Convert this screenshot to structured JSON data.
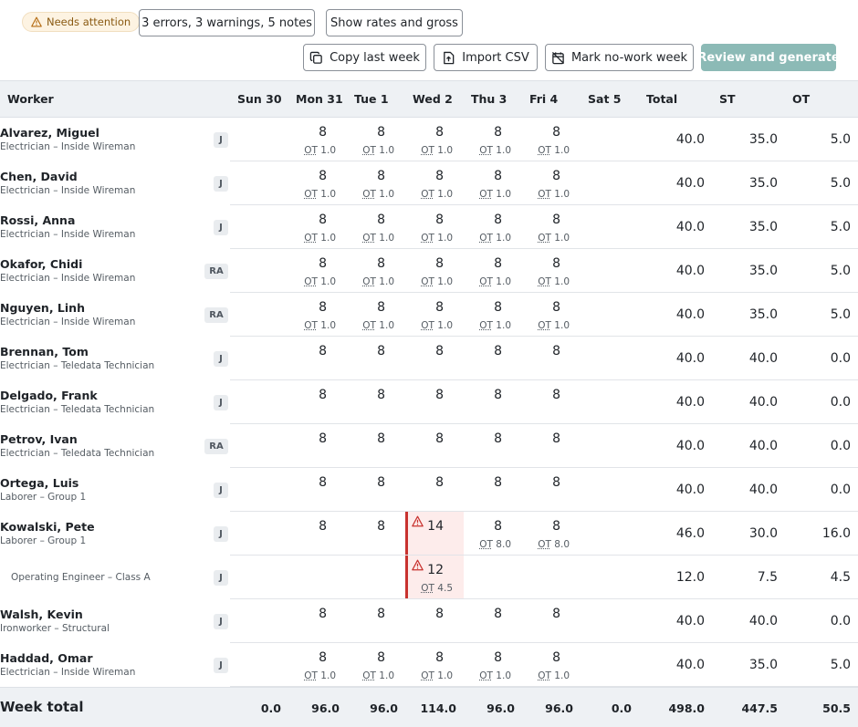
{
  "status": {
    "badge": "Needs attention",
    "summary": "3 errors, 3 warnings, 5 notes",
    "toggle": "Show rates and gross"
  },
  "toolbar": {
    "copy": "Copy last week",
    "import": "Import CSV",
    "no_work": "Mark no-work week",
    "review": "Review and generate"
  },
  "columns": {
    "worker": "Worker",
    "days": [
      "Sun 30",
      "Mon 31",
      "Tue 1",
      "Wed 2",
      "Thu 3",
      "Fri 4",
      "Sat 5"
    ],
    "total": "Total",
    "st": "ST",
    "ot": "OT"
  },
  "ot_label": "OT",
  "rows": [
    {
      "name": "Alvarez, Miguel",
      "classification": "Electrician – Inside Wireman",
      "tag": "J",
      "days": [
        null,
        {
          "h": "8",
          "ot": "1.0"
        },
        {
          "h": "8",
          "ot": "1.0"
        },
        {
          "h": "8",
          "ot": "1.0"
        },
        {
          "h": "8",
          "ot": "1.0"
        },
        {
          "h": "8",
          "ot": "1.0"
        },
        null
      ],
      "total": "40.0",
      "st": "35.0",
      "ot": "5.0"
    },
    {
      "name": "Chen, David",
      "classification": "Electrician – Inside Wireman",
      "tag": "J",
      "days": [
        null,
        {
          "h": "8",
          "ot": "1.0"
        },
        {
          "h": "8",
          "ot": "1.0"
        },
        {
          "h": "8",
          "ot": "1.0"
        },
        {
          "h": "8",
          "ot": "1.0"
        },
        {
          "h": "8",
          "ot": "1.0"
        },
        null
      ],
      "total": "40.0",
      "st": "35.0",
      "ot": "5.0"
    },
    {
      "name": "Rossi, Anna",
      "classification": "Electrician – Inside Wireman",
      "tag": "J",
      "days": [
        null,
        {
          "h": "8",
          "ot": "1.0"
        },
        {
          "h": "8",
          "ot": "1.0"
        },
        {
          "h": "8",
          "ot": "1.0"
        },
        {
          "h": "8",
          "ot": "1.0"
        },
        {
          "h": "8",
          "ot": "1.0"
        },
        null
      ],
      "total": "40.0",
      "st": "35.0",
      "ot": "5.0"
    },
    {
      "name": "Okafor, Chidi",
      "classification": "Electrician – Inside Wireman",
      "tag": "RA",
      "days": [
        null,
        {
          "h": "8",
          "ot": "1.0"
        },
        {
          "h": "8",
          "ot": "1.0"
        },
        {
          "h": "8",
          "ot": "1.0"
        },
        {
          "h": "8",
          "ot": "1.0"
        },
        {
          "h": "8",
          "ot": "1.0"
        },
        null
      ],
      "total": "40.0",
      "st": "35.0",
      "ot": "5.0"
    },
    {
      "name": "Nguyen, Linh",
      "classification": "Electrician – Inside Wireman",
      "tag": "RA",
      "days": [
        null,
        {
          "h": "8",
          "ot": "1.0"
        },
        {
          "h": "8",
          "ot": "1.0"
        },
        {
          "h": "8",
          "ot": "1.0"
        },
        {
          "h": "8",
          "ot": "1.0"
        },
        {
          "h": "8",
          "ot": "1.0"
        },
        null
      ],
      "total": "40.0",
      "st": "35.0",
      "ot": "5.0"
    },
    {
      "name": "Brennan, Tom",
      "classification": "Electrician – Teledata Technician",
      "tag": "J",
      "days": [
        null,
        {
          "h": "8"
        },
        {
          "h": "8"
        },
        {
          "h": "8"
        },
        {
          "h": "8"
        },
        {
          "h": "8"
        },
        null
      ],
      "total": "40.0",
      "st": "40.0",
      "ot": "0.0"
    },
    {
      "name": "Delgado, Frank",
      "classification": "Electrician – Teledata Technician",
      "tag": "J",
      "days": [
        null,
        {
          "h": "8"
        },
        {
          "h": "8"
        },
        {
          "h": "8"
        },
        {
          "h": "8"
        },
        {
          "h": "8"
        },
        null
      ],
      "total": "40.0",
      "st": "40.0",
      "ot": "0.0"
    },
    {
      "name": "Petrov, Ivan",
      "classification": "Electrician – Teledata Technician",
      "tag": "RA",
      "days": [
        null,
        {
          "h": "8"
        },
        {
          "h": "8"
        },
        {
          "h": "8"
        },
        {
          "h": "8"
        },
        {
          "h": "8"
        },
        null
      ],
      "total": "40.0",
      "st": "40.0",
      "ot": "0.0"
    },
    {
      "name": "Ortega, Luis",
      "classification": "Laborer – Group 1",
      "tag": "J",
      "days": [
        null,
        {
          "h": "8"
        },
        {
          "h": "8"
        },
        {
          "h": "8"
        },
        {
          "h": "8"
        },
        {
          "h": "8"
        },
        null
      ],
      "total": "40.0",
      "st": "40.0",
      "ot": "0.0"
    },
    {
      "name": "Kowalski, Pete",
      "classification": "Laborer – Group 1",
      "tag": "J",
      "days": [
        null,
        {
          "h": "8"
        },
        {
          "h": "8"
        },
        {
          "h": "14",
          "warn": true
        },
        {
          "h": "8",
          "ot": "8.0"
        },
        {
          "h": "8",
          "ot": "8.0"
        },
        null
      ],
      "total": "46.0",
      "st": "30.0",
      "ot": "16.0"
    },
    {
      "name": "",
      "classification": "Operating Engineer – Class A",
      "tag": "J",
      "sub": true,
      "days": [
        null,
        null,
        null,
        {
          "h": "12",
          "ot": "4.5",
          "warn": true
        },
        null,
        null,
        null
      ],
      "total": "12.0",
      "st": "7.5",
      "ot": "4.5"
    },
    {
      "name": "Walsh, Kevin",
      "classification": "Ironworker – Structural",
      "tag": "J",
      "days": [
        null,
        {
          "h": "8"
        },
        {
          "h": "8"
        },
        {
          "h": "8"
        },
        {
          "h": "8"
        },
        {
          "h": "8"
        },
        null
      ],
      "total": "40.0",
      "st": "40.0",
      "ot": "0.0"
    },
    {
      "name": "Haddad, Omar",
      "classification": "Electrician – Inside Wireman",
      "tag": "J",
      "days": [
        null,
        {
          "h": "8",
          "ot": "1.0"
        },
        {
          "h": "8",
          "ot": "1.0"
        },
        {
          "h": "8",
          "ot": "1.0"
        },
        {
          "h": "8",
          "ot": "1.0"
        },
        {
          "h": "8",
          "ot": "1.0"
        },
        null
      ],
      "total": "40.0",
      "st": "35.0",
      "ot": "5.0"
    }
  ],
  "footer": {
    "label": "Week total",
    "days": [
      "0.0",
      "96.0",
      "96.0",
      "114.0",
      "96.0",
      "96.0",
      "0.0"
    ],
    "total": "498.0",
    "st": "447.5",
    "ot": "50.5"
  },
  "colors": {
    "accent": "#8cbab6",
    "warning": "#c8322e",
    "warning_bg": "#fdeceb",
    "badge_bg": "#fdf3e2"
  },
  "icons": {
    "badge": "warning-triangle-icon",
    "copy": "copy-icon",
    "import": "file-import-icon",
    "no_work": "calendar-off-icon"
  }
}
